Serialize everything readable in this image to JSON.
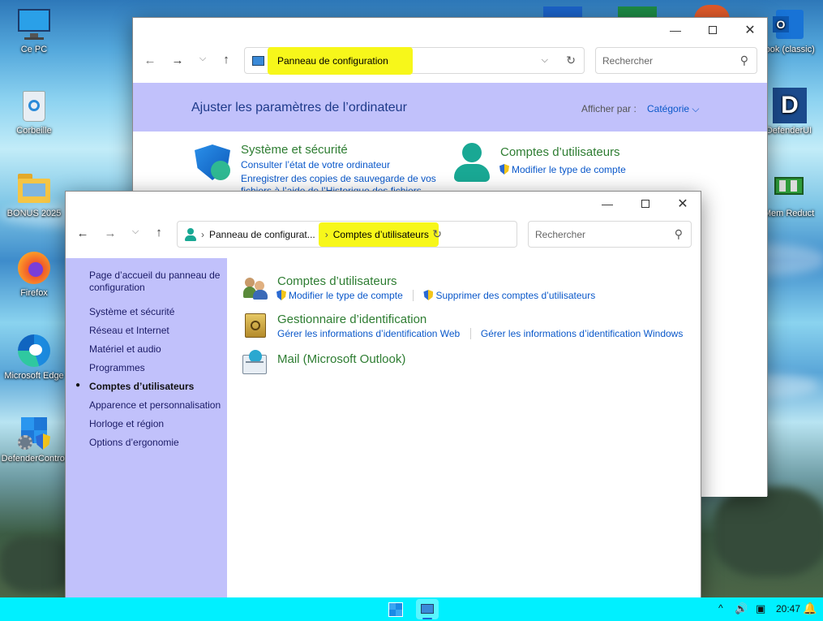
{
  "desktop": {
    "icons": [
      {
        "label": "Ce PC",
        "icon": "computer-icon"
      },
      {
        "label": "Corbeille",
        "icon": "recycle-bin-icon"
      },
      {
        "label": "BONUS 2025",
        "icon": "folder-icon"
      },
      {
        "label": "Firefox",
        "icon": "firefox-icon"
      },
      {
        "label": "Microsoft Edge",
        "icon": "edge-icon"
      },
      {
        "label": "DefenderControl",
        "icon": "defender-control-icon"
      }
    ],
    "right_icons": [
      {
        "label": "look (classic)",
        "icon": "outlook-icon"
      },
      {
        "label": "DefenderUI",
        "icon": "defenderui-icon"
      },
      {
        "label": "Mem Reduct",
        "icon": "memreduct-icon"
      }
    ]
  },
  "back_window": {
    "breadcrumb": "Panneau de configuration",
    "search_placeholder": "Rechercher",
    "header_title": "Ajuster les paramètres de l’ordinateur",
    "view_by_label": "Afficher par :",
    "view_by_value": "Catégorie",
    "categories": [
      {
        "title": "Système et sécurité",
        "links": [
          "Consulter l’état de votre ordinateur",
          "Enregistrer des copies de sauvegarde de vos",
          "fichiers à l’aide de l’Historique des fichiers"
        ]
      },
      {
        "title": "Comptes d’utilisateurs",
        "links": [
          "Modifier le type de compte"
        ]
      }
    ]
  },
  "front_window": {
    "breadcrumb": [
      "Panneau de configurat...",
      "Comptes d’utilisateurs"
    ],
    "search_placeholder": "Rechercher",
    "sidebar": {
      "home": "Page d’accueil du panneau de configuration",
      "items": [
        "Système et sécurité",
        "Réseau et Internet",
        "Matériel et audio",
        "Programmes",
        "Comptes d’utilisateurs",
        "Apparence et personnalisation",
        "Horloge et région",
        "Options d’ergonomie"
      ],
      "active": "Comptes d’utilisateurs"
    },
    "sections": [
      {
        "title": "Comptes d’utilisateurs",
        "links": [
          "Modifier le type de compte",
          "Supprimer des comptes d’utilisateurs"
        ],
        "icon": "users-icon"
      },
      {
        "title": "Gestionnaire d’identification",
        "links": [
          "Gérer les informations d’identification Web",
          "Gérer les informations d’identification Windows"
        ],
        "icon": "credential-vault-icon"
      },
      {
        "title": "Mail (Microsoft Outlook)",
        "links": [],
        "icon": "mail-icon"
      }
    ]
  },
  "taskbar": {
    "time": "20:47"
  },
  "colors": {
    "header_band": "#c1c1fb",
    "sidebar": "#c1c1fb",
    "highlight": "#f7f71a",
    "taskbar": "#00f0ff",
    "link": "#0a58ca",
    "category_title": "#2e7d32"
  }
}
